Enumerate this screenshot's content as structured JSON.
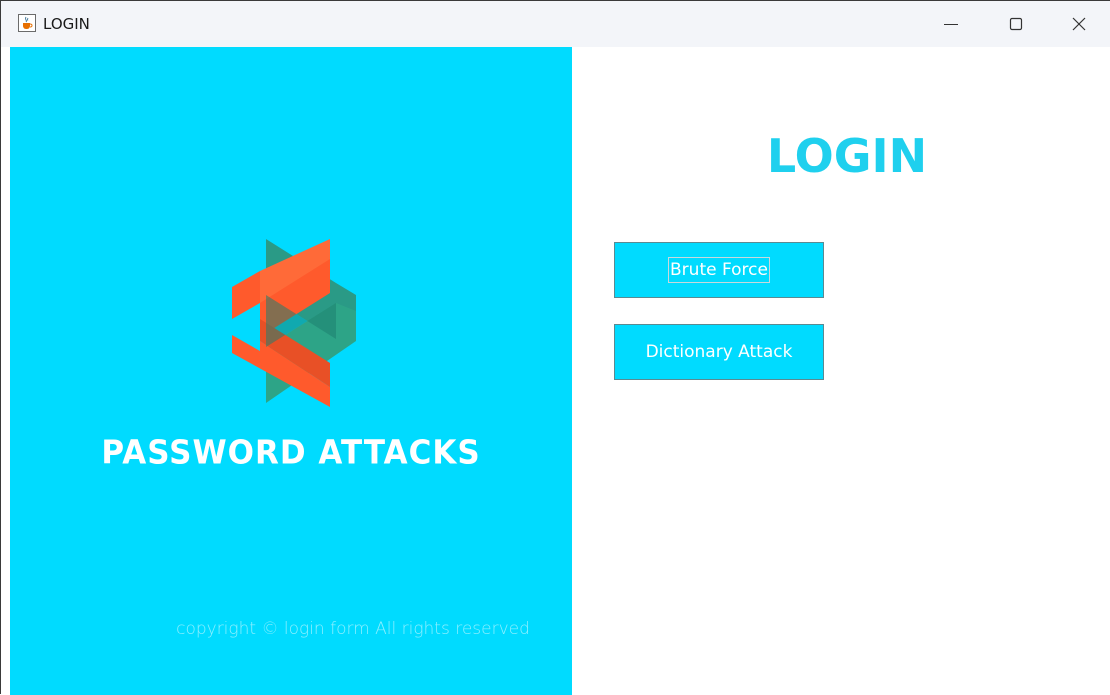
{
  "window": {
    "title": "LOGIN",
    "icon": "java-cup-icon",
    "controls": [
      "minimize",
      "maximize",
      "close"
    ]
  },
  "left_panel": {
    "background": "#00dbff",
    "logo": "password-attacks-logo",
    "brand_text": "PASSWORD ATTACKS",
    "copyright": "copyright © login form All rights reserved"
  },
  "right_panel": {
    "title": "LOGIN",
    "title_color": "#1fd0ee",
    "buttons": [
      {
        "label": "Brute Force",
        "focused": true
      },
      {
        "label": "Dictionary Attack",
        "focused": false
      }
    ]
  }
}
